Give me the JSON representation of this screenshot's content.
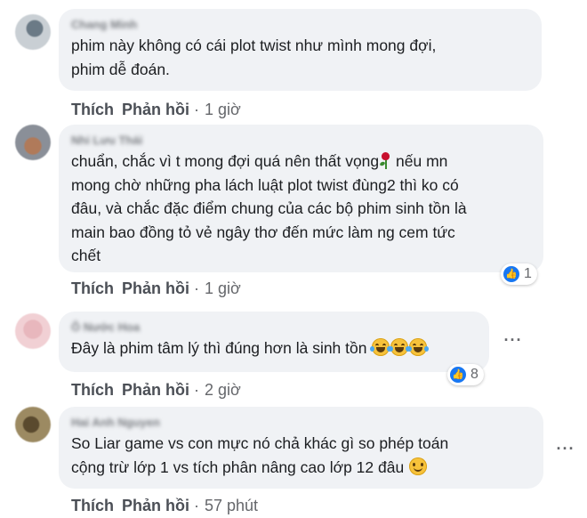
{
  "comments": [
    {
      "author": "Chang Minh",
      "text": "phim này không có cái plot twist như mình mong đợi,\nphim dễ đoán.",
      "like_label": "Thích",
      "reply_label": "Phản hồi",
      "time": "1 giờ"
    },
    {
      "author": "Nhi Lưu Thái",
      "text_part1": "chuẩn, chắc vì t mong đợi quá nên thất vọng",
      "emoji": "rose-emoji",
      "text_part2": " nếu mn\nmong chờ những pha lách luật plot twist đùng2 thì ko có\nđâu, và chắc đặc điểm chung của các bộ phim sinh tồn là\nmain bao đồng tỏ vẻ ngây thơ đến mức làm ng cem tức\nchết",
      "like_label": "Thích",
      "reply_label": "Phản hồi",
      "time": "1 giờ",
      "reaction_count": "1"
    },
    {
      "author": "Ô Nước Hoa",
      "text": "Đây là phim tâm lý thì đúng hơn là sinh tồn ",
      "emoji": "joy-emoji x3",
      "like_label": "Thích",
      "reply_label": "Phản hồi",
      "time": "2 giờ",
      "reaction_count": "8"
    },
    {
      "author": "Hai Anh Nguyen",
      "text": "So Liar game vs con mực nó chả khác gì so phép toán\ncộng trừ lớp 1 vs tích phân nâng cao lớp 12 đâu ",
      "emoji": "smile-emoji",
      "like_label": "Thích",
      "reply_label": "Phản hồi",
      "time": "57 phút"
    }
  ],
  "separator": "·",
  "more_glyph": "···",
  "colors": {
    "bubble": "#f0f2f5",
    "text": "#1c1e21",
    "meta": "#65676b",
    "like_blue": "#1877f2"
  }
}
